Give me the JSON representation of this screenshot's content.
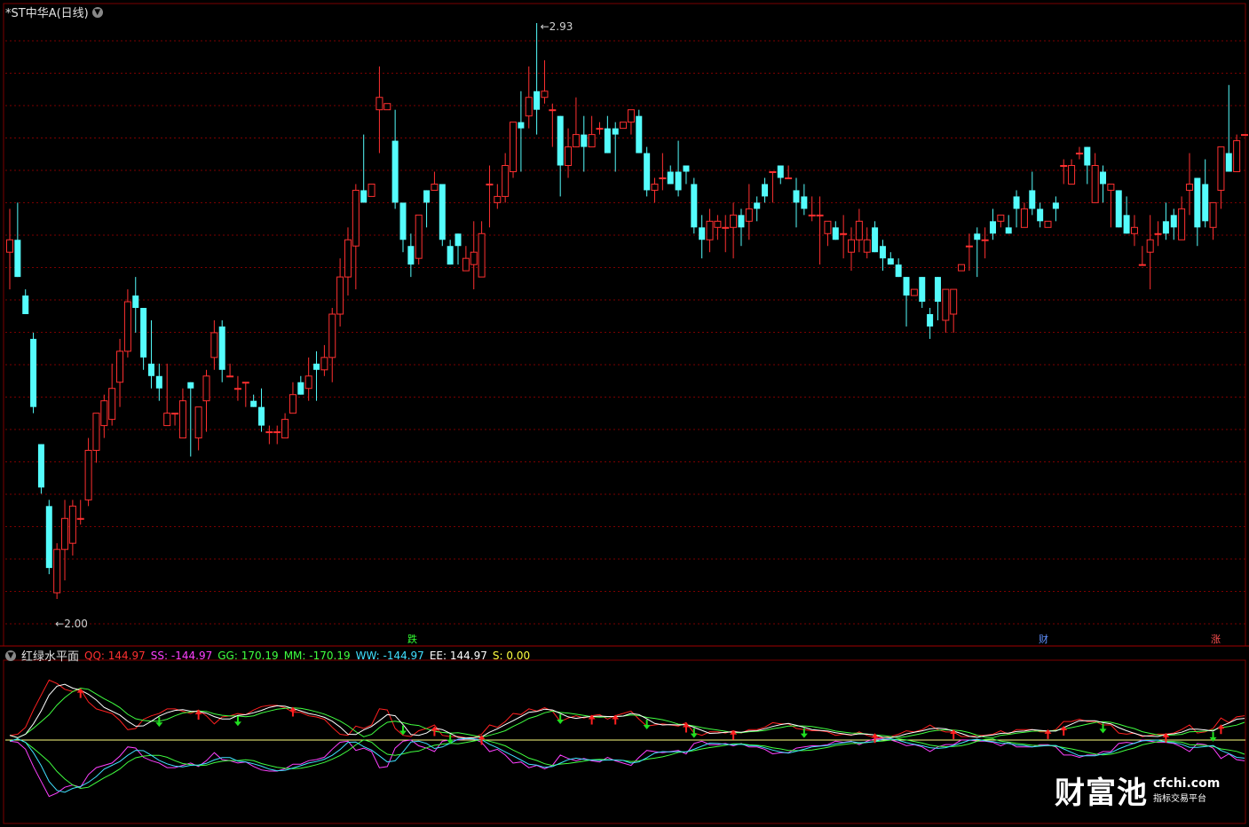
{
  "header": {
    "title": "*ST中华A(日线)",
    "collapse_icon": "chevron-down-icon"
  },
  "chart_data": {
    "type": "candlestick",
    "high_label": "2.93",
    "low_label": "2.00",
    "candles": [
      [
        2.56,
        2.58,
        2.5,
        2.63
      ],
      [
        2.58,
        2.52,
        2.52,
        2.64
      ],
      [
        2.49,
        2.46,
        2.46,
        2.5
      ],
      [
        2.42,
        2.31,
        2.3,
        2.43
      ],
      [
        2.25,
        2.18,
        2.17,
        2.25
      ],
      [
        2.15,
        2.05,
        2.04,
        2.16
      ],
      [
        2.01,
        2.08,
        2.0,
        2.09
      ],
      [
        2.08,
        2.13,
        2.03,
        2.16
      ],
      [
        2.09,
        2.15,
        2.07,
        2.16
      ],
      [
        2.13,
        2.13,
        2.12,
        2.16
      ],
      [
        2.16,
        2.24,
        2.15,
        2.26
      ],
      [
        2.24,
        2.3,
        2.22,
        2.3
      ],
      [
        2.28,
        2.32,
        2.26,
        2.33
      ],
      [
        2.29,
        2.34,
        2.28,
        2.38
      ],
      [
        2.35,
        2.4,
        2.31,
        2.42
      ],
      [
        2.4,
        2.48,
        2.39,
        2.5
      ],
      [
        2.49,
        2.47,
        2.43,
        2.52
      ],
      [
        2.47,
        2.39,
        2.37,
        2.47
      ],
      [
        2.38,
        2.36,
        2.34,
        2.45
      ],
      [
        2.36,
        2.34,
        2.32,
        2.38
      ],
      [
        2.28,
        2.3,
        2.3,
        2.38
      ],
      [
        2.3,
        2.3,
        2.28,
        2.3
      ],
      [
        2.26,
        2.32,
        2.26,
        2.34
      ],
      [
        2.35,
        2.34,
        2.23,
        2.35
      ],
      [
        2.26,
        2.31,
        2.24,
        2.31
      ],
      [
        2.32,
        2.36,
        2.27,
        2.37
      ],
      [
        2.39,
        2.43,
        2.37,
        2.45
      ],
      [
        2.44,
        2.37,
        2.35,
        2.45
      ],
      [
        2.36,
        2.36,
        2.36,
        2.38
      ],
      [
        2.34,
        2.34,
        2.32,
        2.36
      ],
      [
        2.35,
        2.35,
        2.31,
        2.35
      ],
      [
        2.32,
        2.31,
        2.31,
        2.33
      ],
      [
        2.31,
        2.28,
        2.27,
        2.34
      ],
      [
        2.27,
        2.27,
        2.25,
        2.28
      ],
      [
        2.27,
        2.27,
        2.25,
        2.28
      ],
      [
        2.26,
        2.29,
        2.26,
        2.3
      ],
      [
        2.3,
        2.33,
        2.3,
        2.35
      ],
      [
        2.35,
        2.33,
        2.33,
        2.36
      ],
      [
        2.34,
        2.36,
        2.32,
        2.39
      ],
      [
        2.38,
        2.37,
        2.32,
        2.4
      ],
      [
        2.37,
        2.39,
        2.36,
        2.41
      ],
      [
        2.39,
        2.46,
        2.35,
        2.47
      ],
      [
        2.46,
        2.52,
        2.44,
        2.55
      ],
      [
        2.52,
        2.58,
        2.49,
        2.6
      ],
      [
        2.57,
        2.66,
        2.5,
        2.67
      ],
      [
        2.66,
        2.64,
        2.64,
        2.75
      ],
      [
        2.65,
        2.67,
        2.67,
        2.67
      ],
      [
        2.79,
        2.81,
        2.72,
        2.86
      ],
      [
        2.79,
        2.8,
        2.79,
        2.8
      ],
      [
        2.74,
        2.64,
        2.63,
        2.79
      ],
      [
        2.64,
        2.58,
        2.56,
        2.59
      ],
      [
        2.57,
        2.54,
        2.52,
        2.59
      ],
      [
        2.55,
        2.62,
        2.54,
        2.62
      ],
      [
        2.66,
        2.64,
        2.6,
        2.66
      ],
      [
        2.66,
        2.67,
        2.67,
        2.69
      ],
      [
        2.67,
        2.58,
        2.57,
        2.65
      ],
      [
        2.57,
        2.54,
        2.54,
        2.58
      ],
      [
        2.59,
        2.57,
        2.54,
        2.59
      ],
      [
        2.53,
        2.55,
        2.54,
        2.57
      ],
      [
        2.54,
        2.56,
        2.5,
        2.61
      ],
      [
        2.52,
        2.59,
        2.52,
        2.61
      ],
      [
        2.67,
        2.67,
        2.6,
        2.7
      ],
      [
        2.64,
        2.65,
        2.63,
        2.67
      ],
      [
        2.65,
        2.7,
        2.64,
        2.72
      ],
      [
        2.69,
        2.77,
        2.68,
        2.77
      ],
      [
        2.77,
        2.76,
        2.69,
        2.82
      ],
      [
        2.78,
        2.81,
        2.76,
        2.86
      ],
      [
        2.82,
        2.79,
        2.75,
        2.93
      ],
      [
        2.81,
        2.82,
        2.8,
        2.87
      ],
      [
        2.79,
        2.79,
        2.73,
        2.8
      ],
      [
        2.78,
        2.7,
        2.65,
        2.78
      ],
      [
        2.7,
        2.73,
        2.68,
        2.76
      ],
      [
        2.73,
        2.75,
        2.74,
        2.81
      ],
      [
        2.75,
        2.73,
        2.69,
        2.78
      ],
      [
        2.73,
        2.75,
        2.73,
        2.78
      ],
      [
        2.76,
        2.76,
        2.75,
        2.77
      ],
      [
        2.76,
        2.72,
        2.72,
        2.78
      ],
      [
        2.76,
        2.75,
        2.69,
        2.77
      ],
      [
        2.76,
        2.77,
        2.76,
        2.77
      ],
      [
        2.77,
        2.79,
        2.75,
        2.79
      ],
      [
        2.78,
        2.72,
        2.72,
        2.79
      ],
      [
        2.72,
        2.66,
        2.65,
        2.73
      ],
      [
        2.66,
        2.67,
        2.64,
        2.68
      ],
      [
        2.68,
        2.68,
        2.66,
        2.72
      ],
      [
        2.69,
        2.67,
        2.67,
        2.7
      ],
      [
        2.69,
        2.66,
        2.65,
        2.74
      ],
      [
        2.7,
        2.69,
        2.67,
        2.7
      ],
      [
        2.67,
        2.6,
        2.59,
        2.68
      ],
      [
        2.6,
        2.58,
        2.55,
        2.62
      ],
      [
        2.58,
        2.61,
        2.56,
        2.63
      ],
      [
        2.6,
        2.61,
        2.58,
        2.62
      ],
      [
        2.6,
        2.6,
        2.56,
        2.62
      ],
      [
        2.6,
        2.62,
        2.55,
        2.64
      ],
      [
        2.62,
        2.6,
        2.57,
        2.63
      ],
      [
        2.61,
        2.63,
        2.58,
        2.67
      ],
      [
        2.64,
        2.63,
        2.61,
        2.65
      ],
      [
        2.67,
        2.65,
        2.64,
        2.68
      ],
      [
        2.69,
        2.69,
        2.64,
        2.69
      ],
      [
        2.7,
        2.68,
        2.67,
        2.7
      ],
      [
        2.68,
        2.68,
        2.68,
        2.7
      ],
      [
        2.66,
        2.64,
        2.6,
        2.68
      ],
      [
        2.65,
        2.63,
        2.62,
        2.67
      ],
      [
        2.62,
        2.62,
        2.61,
        2.65
      ],
      [
        2.62,
        2.62,
        2.54,
        2.65
      ],
      [
        2.59,
        2.61,
        2.57,
        2.61
      ],
      [
        2.6,
        2.58,
        2.58,
        2.61
      ],
      [
        2.59,
        2.59,
        2.55,
        2.62
      ],
      [
        2.56,
        2.58,
        2.53,
        2.6
      ],
      [
        2.58,
        2.61,
        2.56,
        2.63
      ],
      [
        2.56,
        2.58,
        2.55,
        2.6
      ],
      [
        2.6,
        2.56,
        2.56,
        2.61
      ],
      [
        2.57,
        2.55,
        2.53,
        2.58
      ],
      [
        2.55,
        2.54,
        2.54,
        2.56
      ],
      [
        2.54,
        2.52,
        2.52,
        2.55
      ],
      [
        2.52,
        2.49,
        2.44,
        2.52
      ],
      [
        2.49,
        2.5,
        2.49,
        2.5
      ],
      [
        2.52,
        2.48,
        2.47,
        2.52
      ],
      [
        2.46,
        2.44,
        2.42,
        2.47
      ],
      [
        2.52,
        2.48,
        2.45,
        2.52
      ],
      [
        2.45,
        2.5,
        2.43,
        2.5
      ],
      [
        2.46,
        2.5,
        2.43,
        2.5
      ],
      [
        2.53,
        2.54,
        2.53,
        2.54
      ],
      [
        2.57,
        2.57,
        2.53,
        2.59
      ],
      [
        2.59,
        2.58,
        2.52,
        2.6
      ],
      [
        2.58,
        2.58,
        2.55,
        2.6
      ],
      [
        2.61,
        2.59,
        2.58,
        2.63
      ],
      [
        2.61,
        2.62,
        2.6,
        2.62
      ],
      [
        2.6,
        2.59,
        2.59,
        2.62
      ],
      [
        2.65,
        2.63,
        2.6,
        2.66
      ],
      [
        2.6,
        2.63,
        2.6,
        2.64
      ],
      [
        2.66,
        2.63,
        2.62,
        2.69
      ],
      [
        2.63,
        2.61,
        2.6,
        2.64
      ],
      [
        2.6,
        2.61,
        2.6,
        2.61
      ],
      [
        2.64,
        2.63,
        2.61,
        2.65
      ],
      [
        2.7,
        2.7,
        2.67,
        2.71
      ],
      [
        2.67,
        2.7,
        2.67,
        2.71
      ],
      [
        2.72,
        2.72,
        2.71,
        2.73
      ],
      [
        2.73,
        2.7,
        2.67,
        2.73
      ],
      [
        2.64,
        2.7,
        2.64,
        2.72
      ],
      [
        2.69,
        2.67,
        2.64,
        2.7
      ],
      [
        2.66,
        2.67,
        2.6,
        2.67
      ],
      [
        2.66,
        2.6,
        2.6,
        2.66
      ],
      [
        2.62,
        2.59,
        2.59,
        2.65
      ],
      [
        2.59,
        2.6,
        2.57,
        2.62
      ],
      [
        2.54,
        2.54,
        2.54,
        2.57
      ],
      [
        2.56,
        2.58,
        2.5,
        2.62
      ],
      [
        2.59,
        2.59,
        2.57,
        2.61
      ],
      [
        2.61,
        2.59,
        2.58,
        2.64
      ],
      [
        2.62,
        2.6,
        2.58,
        2.63
      ],
      [
        2.58,
        2.63,
        2.58,
        2.65
      ],
      [
        2.66,
        2.67,
        2.62,
        2.72
      ],
      [
        2.68,
        2.6,
        2.57,
        2.68
      ],
      [
        2.67,
        2.61,
        2.6,
        2.71
      ],
      [
        2.6,
        2.64,
        2.58,
        2.64
      ],
      [
        2.66,
        2.73,
        2.63,
        2.73
      ],
      [
        2.72,
        2.69,
        2.69,
        2.83
      ],
      [
        2.69,
        2.74,
        2.74,
        2.75
      ],
      [
        2.75,
        2.75,
        2.75,
        2.75
      ]
    ]
  },
  "bottom_markers": [
    {
      "label": "跌",
      "color": "#33ff33"
    },
    {
      "label": "财",
      "color": "#4080ff"
    },
    {
      "label": "涨",
      "color": "#ff4040"
    }
  ],
  "indicator": {
    "name": "红绿水平面",
    "values": [
      {
        "label": "QQ:",
        "value": "144.97",
        "color": "#ff3030"
      },
      {
        "label": "SS:",
        "value": "-144.97",
        "color": "#ff40ff"
      },
      {
        "label": "GG:",
        "value": "170.19",
        "color": "#40ff40"
      },
      {
        "label": "MM:",
        "value": "-170.19",
        "color": "#40ff40"
      },
      {
        "label": "WW:",
        "value": "-144.97",
        "color": "#40e0ff"
      },
      {
        "label": "EE:",
        "value": "144.97",
        "color": "#ffffff"
      },
      {
        "label": "S:",
        "value": "0.00",
        "color": "#ffff40"
      }
    ]
  },
  "watermark": {
    "brand": "财富池",
    "url": "cfchi.com",
    "slogan": "指标交易平台"
  },
  "colors": {
    "up": "#ff3030",
    "down": "#54fcfc",
    "grid": "#7a0000",
    "zero_line": "#ffff80"
  }
}
